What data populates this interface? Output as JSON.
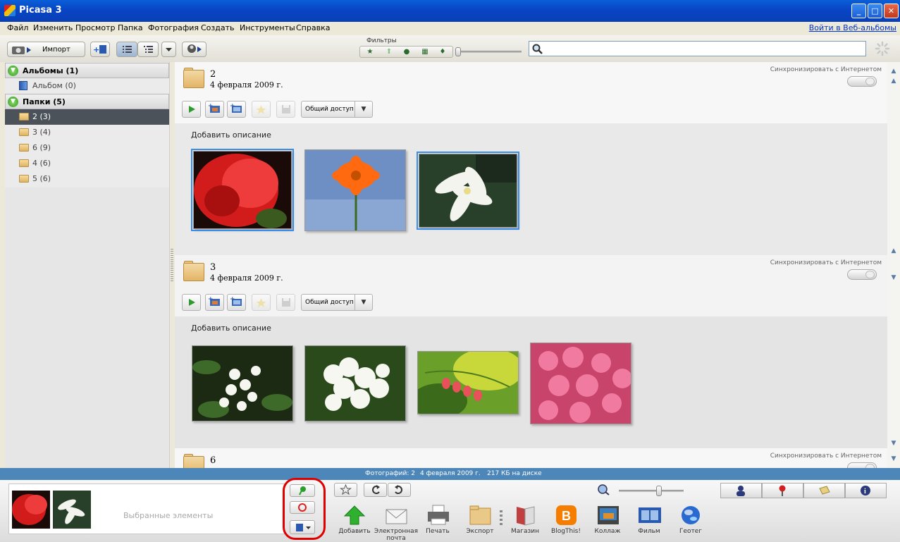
{
  "window": {
    "title": "Picasa 3"
  },
  "menu": {
    "items": [
      "Файл",
      "Изменить",
      "Просмотр",
      "Папка",
      "Фотография",
      "Создать",
      "Инструменты",
      "Справка"
    ],
    "web_link": "Войти в Веб-альбомы"
  },
  "toolbar": {
    "import_label": "Импорт",
    "filters_label": "Фильтры"
  },
  "sidebar": {
    "albums_header": "Альбомы (1)",
    "albums": [
      {
        "label": "Альбом (0)"
      }
    ],
    "folders_header": "Папки (5)",
    "folders": [
      {
        "label": "2 (3)",
        "selected": true
      },
      {
        "label": "3 (4)"
      },
      {
        "label": "6 (9)"
      },
      {
        "label": "4 (6)"
      },
      {
        "label": "5 (6)"
      }
    ]
  },
  "folders": [
    {
      "name": "2",
      "date": "4 февраля 2009 г.",
      "sync_label": "Синхронизировать с Интернетом",
      "share_label": "Общий доступ",
      "desc_placeholder": "Добавить описание"
    },
    {
      "name": "3",
      "date": "4 февраля 2009 г.",
      "sync_label": "Синхронизировать с Интернетом",
      "share_label": "Общий доступ",
      "desc_placeholder": "Добавить описание"
    },
    {
      "name": "6",
      "sync_label": "Синхронизировать с Интернетом"
    }
  ],
  "status": {
    "photos": "Фотографий: 2",
    "date": "4 февраля 2009 г.",
    "size": "217 КБ на диске"
  },
  "tray": {
    "placeholder": "Выбранные элементы"
  },
  "actions": [
    {
      "label": "Добавить",
      "icon": "upload-arrow-icon"
    },
    {
      "label": "Электронная почта",
      "icon": "envelope-icon"
    },
    {
      "label": "Печать",
      "icon": "printer-icon"
    },
    {
      "label": "Экспорт",
      "icon": "folder-export-icon"
    },
    {
      "label": "Магазин",
      "icon": "shop-book-icon"
    },
    {
      "label": "BlogThis!",
      "icon": "blogger-icon"
    },
    {
      "label": "Коллаж",
      "icon": "collage-icon"
    },
    {
      "label": "Фильм",
      "icon": "film-icon"
    },
    {
      "label": "Геотег",
      "icon": "globe-icon"
    }
  ],
  "colors": {
    "accent": "#4d86b8",
    "selection": "#3a8ee8",
    "title_bar": "#0a4fc8",
    "highlight_mark": "#e00000"
  }
}
